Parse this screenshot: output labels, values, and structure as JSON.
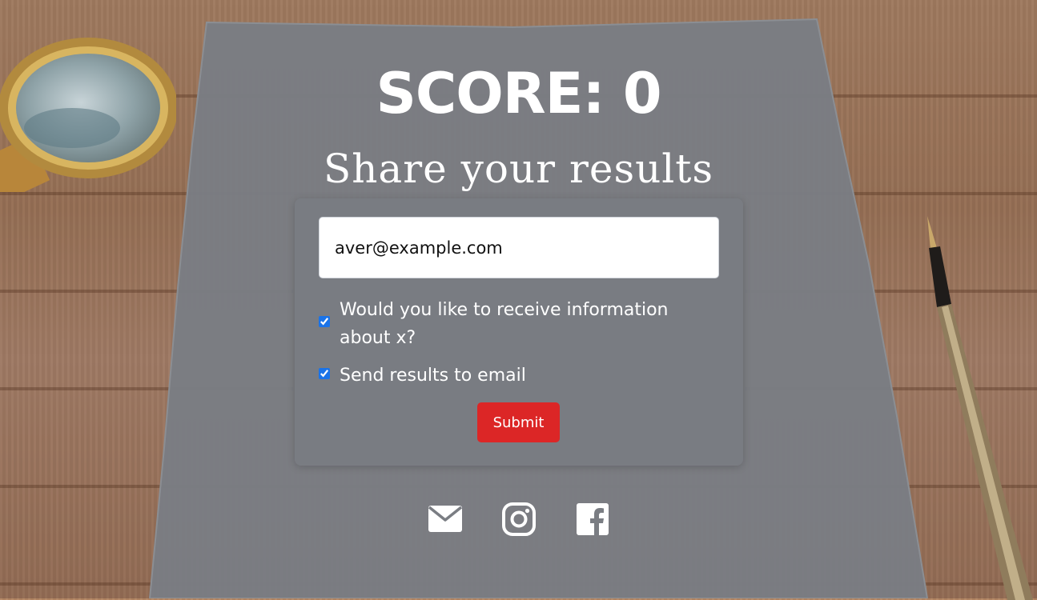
{
  "score": {
    "text": "SCORE: 0"
  },
  "share": {
    "title": "Share your results"
  },
  "form": {
    "email_value": "aver@example.com",
    "options": [
      {
        "label": "Would you like to receive information about x?",
        "checked": true
      },
      {
        "label": "Send results to email",
        "checked": true
      }
    ],
    "submit_label": "Submit",
    "submit_color": "#dc2626"
  },
  "social": {
    "icons": [
      "email-icon",
      "instagram-icon",
      "facebook-icon"
    ]
  }
}
